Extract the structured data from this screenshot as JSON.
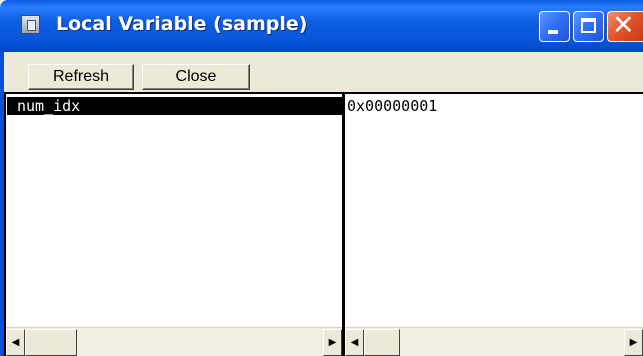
{
  "window": {
    "title": "Local Variable (sample)"
  },
  "toolbar": {
    "refresh_label": "Refresh",
    "close_label": "Close"
  },
  "variables": [
    {
      "name": "num_idx",
      "value": "0x00000001"
    }
  ],
  "icons": {
    "app": "window-app-icon",
    "minimize": "minimize-icon",
    "maximize": "maximize-icon",
    "close": "close-icon",
    "scroll_left": "arrow-left-icon",
    "scroll_right": "arrow-right-icon"
  },
  "glyphs": {
    "scroll_left": "◀",
    "scroll_right": "▶",
    "close_x": "✕"
  },
  "colors": {
    "title_bar": "#0655d8",
    "close_button": "#e0522a",
    "selection": "#000000"
  }
}
